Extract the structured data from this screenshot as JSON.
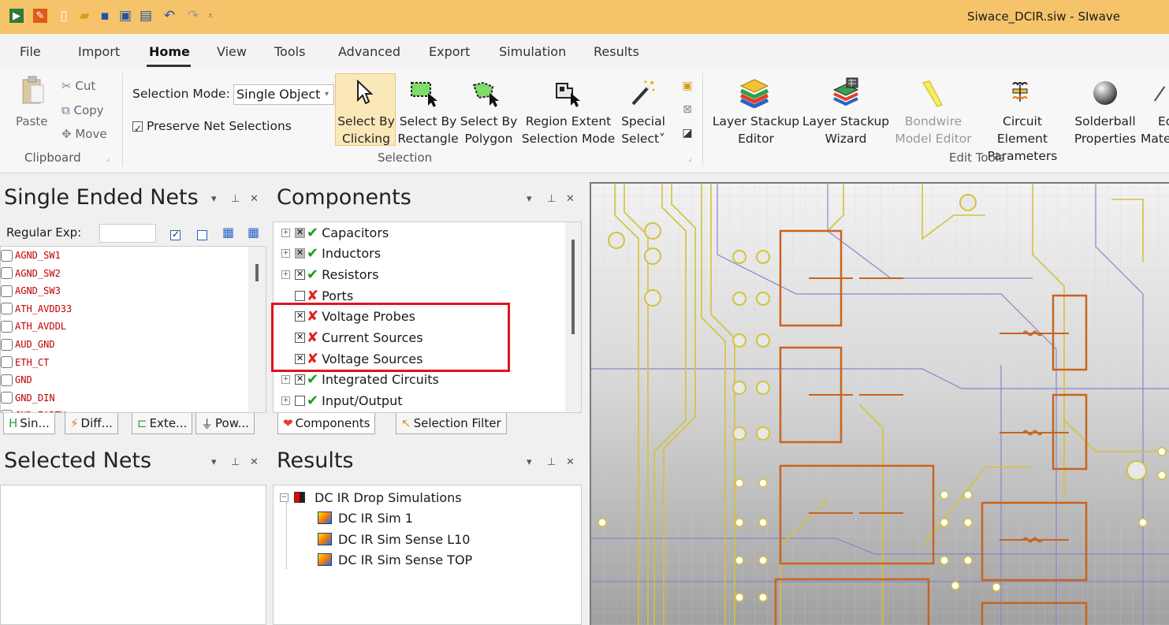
{
  "window": {
    "title": "Siwace_DCIR.siw - SIwave",
    "quick_access": [
      "app-icon",
      "tools-icon",
      "new-icon",
      "open-icon",
      "save-icon",
      "save-as-icon",
      "save-all-icon",
      "undo-icon",
      "redo-icon",
      "customize-icon"
    ]
  },
  "menu": {
    "items": [
      "File",
      "Import",
      "Home",
      "View",
      "Tools",
      "Advanced",
      "Export",
      "Simulation",
      "Results"
    ],
    "active": "Home"
  },
  "ribbon": {
    "clipboard": {
      "paste": "Paste",
      "cut": "Cut",
      "copy": "Copy",
      "move": "Move",
      "group_label": "Clipboard"
    },
    "selection": {
      "mode_label": "Selection Mode:",
      "mode_value": "Single Object",
      "preserve_label": "Preserve Net Selections",
      "preserve_checked": true,
      "buttons": [
        {
          "line1": "Select By",
          "line2": "Clicking"
        },
        {
          "line1": "Select By",
          "line2": "Rectangle"
        },
        {
          "line1": "Select By",
          "line2": "Polygon"
        },
        {
          "line1": "Region Extent",
          "line2": "Selection Mode"
        },
        {
          "line1": "Special",
          "line2": "Select˅"
        }
      ],
      "group_label": "Selection"
    },
    "edit_tools": {
      "buttons": [
        {
          "line1": "Layer Stackup",
          "line2": "Editor"
        },
        {
          "line1": "Layer Stackup",
          "line2": "Wizard"
        },
        {
          "line1": "Bondwire",
          "line2": "Model Editor"
        },
        {
          "line1": "Circuit Element",
          "line2": "Parameters"
        },
        {
          "line1": "Solderball",
          "line2": "Properties"
        },
        {
          "line1": "Ed",
          "line2": "Mate"
        }
      ],
      "group_label": "Edit Tools"
    }
  },
  "single_ended_nets": {
    "title": "Single Ended Nets",
    "regex_label": "Regular Exp:",
    "regex_value": "",
    "nets": [
      "AGND_SW1",
      "AGND_SW2",
      "AGND_SW3",
      "ATH_AVDD33",
      "ATH_AVDDL",
      "AUD_GND",
      "ETH_CT",
      "GND",
      "GND_DIN",
      "GND_EARTH"
    ],
    "tabs": [
      "Sin...",
      "Diff...",
      "Exte...",
      "Pow..."
    ]
  },
  "components": {
    "title": "Components",
    "items": [
      {
        "label": "Capacitors",
        "expandable": true,
        "check": "gray",
        "status": "ok"
      },
      {
        "label": "Inductors",
        "expandable": true,
        "check": "gray",
        "status": "ok"
      },
      {
        "label": "Resistors",
        "expandable": true,
        "check": "x",
        "status": "ok"
      },
      {
        "label": "Ports",
        "expandable": false,
        "check": "empty",
        "status": "bad"
      },
      {
        "label": "Voltage Probes",
        "expandable": false,
        "check": "x",
        "status": "bad"
      },
      {
        "label": "Current Sources",
        "expandable": false,
        "check": "x",
        "status": "bad"
      },
      {
        "label": "Voltage Sources",
        "expandable": false,
        "check": "x",
        "status": "bad"
      },
      {
        "label": "Integrated Circuits",
        "expandable": true,
        "check": "x",
        "status": "ok"
      },
      {
        "label": "Input/Output",
        "expandable": true,
        "check": "empty",
        "status": "ok"
      }
    ],
    "tabs": [
      "Components",
      "Selection Filter"
    ]
  },
  "selected_nets": {
    "title": "Selected Nets"
  },
  "results": {
    "title": "Results",
    "root": "DC IR Drop Simulations",
    "children": [
      "DC IR Sim 1",
      "DC IR Sim Sense L10",
      "DC IR Sim Sense TOP"
    ]
  },
  "colors": {
    "titlebar": "#f5c36a",
    "net_text": "#c00000",
    "highlight": "#e0141e",
    "trace_yellow": "#d4c23a",
    "pad_orange": "#c8641e",
    "trace_purple": "#8a84c8"
  }
}
